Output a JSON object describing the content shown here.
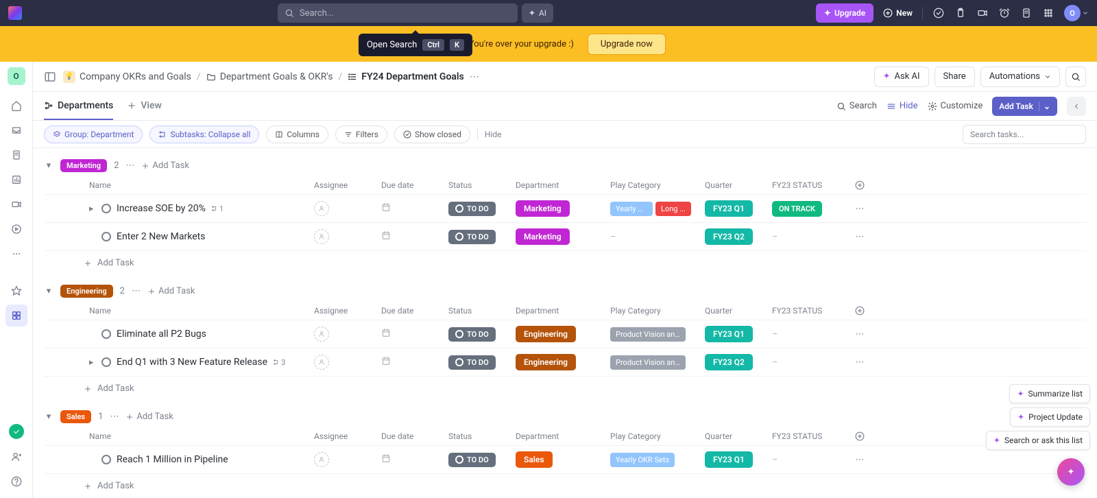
{
  "topnav": {
    "search_placeholder": "Search...",
    "ai": "AI",
    "upgrade": "Upgrade",
    "new": "New",
    "avatar_initial": "O"
  },
  "tooltip": {
    "label": "Open Search",
    "key1": "Ctrl",
    "key2": "K"
  },
  "banner": {
    "text": "Woohoo! You're over your                                               upgrade :)",
    "button": "Upgrade now"
  },
  "workspace_initial": "O",
  "breadcrumb": {
    "space": "Company OKRs and Goals",
    "folder": "Department Goals & OKR's",
    "list": "FY24 Department Goals"
  },
  "header_actions": {
    "ask_ai": "Ask AI",
    "share": "Share",
    "automations": "Automations"
  },
  "views": {
    "active": "Departments",
    "add": "View"
  },
  "view_actions": {
    "search": "Search",
    "hide": "Hide",
    "customize": "Customize",
    "add_task": "Add Task"
  },
  "filters": {
    "group": "Group: Department",
    "subtasks": "Subtasks: Collapse all",
    "columns": "Columns",
    "filters": "Filters",
    "show_closed": "Show closed",
    "hide": "Hide",
    "search_placeholder": "Search tasks..."
  },
  "columns": [
    "Name",
    "Assignee",
    "Due date",
    "Status",
    "Department",
    "Play Category",
    "Quarter",
    "FY23 STATUS"
  ],
  "labels": {
    "add_task": "Add Task"
  },
  "groups": [
    {
      "name": "Marketing",
      "class": "g-marketing",
      "count": 2,
      "tasks": [
        {
          "name": "Increase SOE by 20%",
          "subtasks": "1",
          "has_expand": true,
          "status": "TO DO",
          "dept": "Marketing",
          "dept_class": "d-marketing",
          "play": [
            {
              "t": "Yearly OK...",
              "c": "p-yearly"
            },
            {
              "t": "Long ...",
              "c": "p-long"
            }
          ],
          "quarter": "FY23 Q1",
          "fy23": "ON TRACK"
        },
        {
          "name": "Enter 2 New Markets",
          "subtasks": "",
          "has_expand": false,
          "status": "TO DO",
          "dept": "Marketing",
          "dept_class": "d-marketing",
          "play": [],
          "quarter": "FY23 Q2",
          "fy23": ""
        }
      ]
    },
    {
      "name": "Engineering",
      "class": "g-engineering",
      "count": 2,
      "tasks": [
        {
          "name": "Eliminate all P2 Bugs",
          "subtasks": "",
          "has_expand": false,
          "status": "TO DO",
          "dept": "Engineering",
          "dept_class": "d-engineering",
          "play": [
            {
              "t": "Product Vision and ...",
              "c": "p-product"
            }
          ],
          "quarter": "FY23 Q1",
          "fy23": ""
        },
        {
          "name": "End Q1 with 3 New Feature Release",
          "subtasks": "3",
          "has_expand": true,
          "status": "TO DO",
          "dept": "Engineering",
          "dept_class": "d-engineering",
          "play": [
            {
              "t": "Product Vision and ...",
              "c": "p-product"
            }
          ],
          "quarter": "FY23 Q2",
          "fy23": ""
        }
      ]
    },
    {
      "name": "Sales",
      "class": "g-sales",
      "count": 1,
      "tasks": [
        {
          "name": "Reach 1 Million in Pipeline",
          "subtasks": "",
          "has_expand": false,
          "status": "TO DO",
          "dept": "Sales",
          "dept_class": "d-sales",
          "play": [
            {
              "t": "Yearly OKR Sets",
              "c": "p-yearlyf"
            }
          ],
          "quarter": "FY23 Q1",
          "fy23": ""
        }
      ]
    }
  ],
  "float": {
    "summarize": "Summarize list",
    "project_update": "Project Update",
    "search_ask": "Search or ask this list"
  }
}
